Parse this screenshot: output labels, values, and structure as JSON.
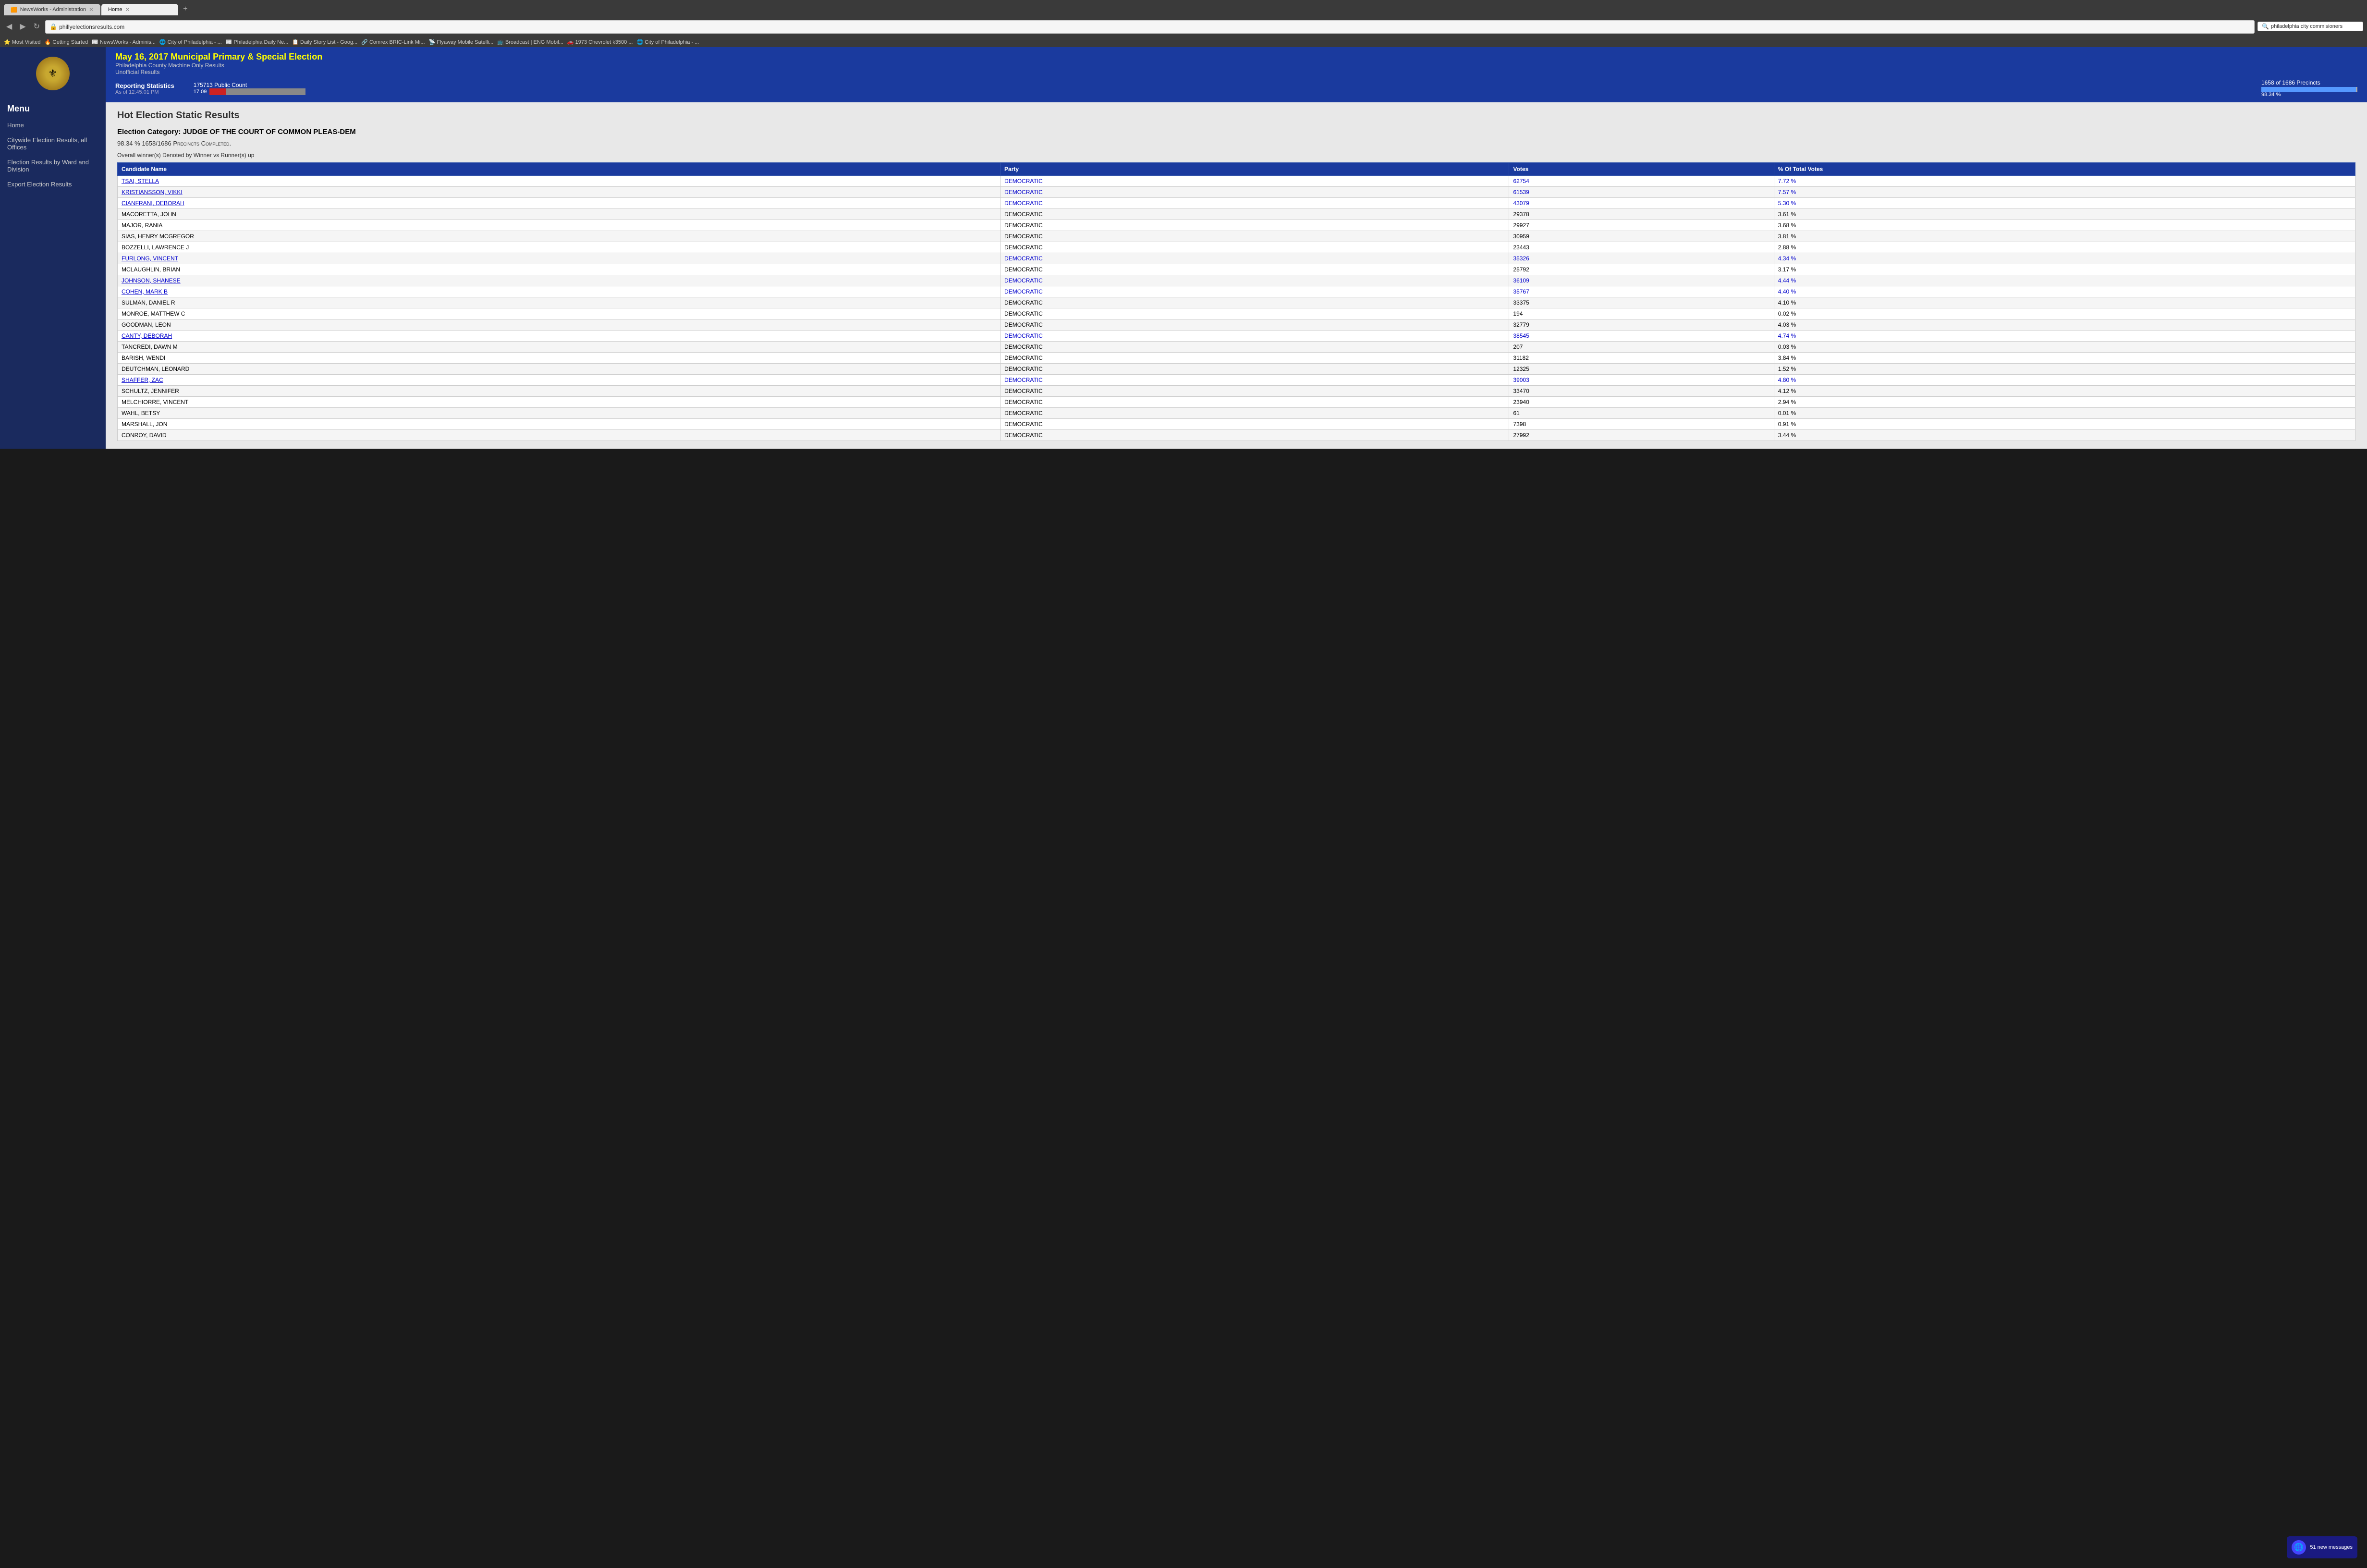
{
  "browser": {
    "tabs": [
      {
        "id": "tab1",
        "label": "NewsWorks - Administration",
        "active": false,
        "icon": "🟧"
      },
      {
        "id": "tab2",
        "label": "Home",
        "active": true,
        "icon": ""
      }
    ],
    "url": "phillyelectionsresults.com",
    "search_text": "philadelphia city commisioners",
    "bookmarks": [
      "Most Visited",
      "Getting Started",
      "NewsWorks - Adminis...",
      "City of Philadelphia - ...",
      "Philadelphia Daily Ne...",
      "Daily Story List - Goog...",
      "Comrex BRIC-Link Mi...",
      "Flyaway Mobile Satelli...",
      "Broadcast | ENG Mobil...",
      "1973 Chevrolet k3500 ...",
      "City of Philadelphia - ..."
    ]
  },
  "header": {
    "election_title": "May 16, 2017 Municipal Primary & Special Election",
    "sub1": "Philadelphia County Machine Only Results",
    "sub2": "Unofficial Results",
    "reporting_label": "Reporting Statistics",
    "as_of": "As of 12:45:01 PM",
    "public_count_label": "175713 Public Count",
    "public_pct": "17.09",
    "precincts_label": "1658 of 1686 Precincts",
    "precincts_pct": "98.34 %"
  },
  "sidebar": {
    "menu_title": "Menu",
    "items": [
      {
        "label": "Home",
        "id": "home"
      },
      {
        "label": "Citywide Election Results, all Offices",
        "id": "citywide"
      },
      {
        "label": "Election Results by Ward and Division",
        "id": "ward-division"
      },
      {
        "label": "Export Election Results",
        "id": "export"
      }
    ]
  },
  "main": {
    "page_title": "Hot Election Static Results",
    "election_category": "Election Category: JUDGE OF THE COURT OF COMMON PLEAS-DEM",
    "precincts_completed": "98.34 % 1658/1686 Precincts Completed.",
    "winner_note": "Overall winner(s) Denoted by Winner vs Runner(s) up",
    "table_headers": [
      "Candidate Name",
      "Party",
      "Votes",
      "% Of Total Votes"
    ],
    "candidates": [
      {
        "name": "TSAI, STELLA",
        "party": "DEMOCRATIC",
        "votes": "62754",
        "pct": "7.72 %",
        "winner": true
      },
      {
        "name": "KRISTIANSSON, VIKKI",
        "party": "DEMOCRATIC",
        "votes": "61539",
        "pct": "7.57 %",
        "winner": true
      },
      {
        "name": "CIANFRANI, DEBORAH",
        "party": "DEMOCRATIC",
        "votes": "43079",
        "pct": "5.30 %",
        "winner": true
      },
      {
        "name": "MACORETTA, JOHN",
        "party": "DEMOCRATIC",
        "votes": "29378",
        "pct": "3.61 %",
        "winner": false
      },
      {
        "name": "MAJOR, RANIA",
        "party": "DEMOCRATIC",
        "votes": "29927",
        "pct": "3.68 %",
        "winner": false
      },
      {
        "name": "SIAS, HENRY MCGREGOR",
        "party": "DEMOCRATIC",
        "votes": "30959",
        "pct": "3.81 %",
        "winner": false
      },
      {
        "name": "BOZZELLI, LAWRENCE J",
        "party": "DEMOCRATIC",
        "votes": "23443",
        "pct": "2.88 %",
        "winner": false
      },
      {
        "name": "FURLONG, VINCENT",
        "party": "DEMOCRATIC",
        "votes": "35326",
        "pct": "4.34 %",
        "winner": true
      },
      {
        "name": "MCLAUGHLIN, BRIAN",
        "party": "DEMOCRATIC",
        "votes": "25792",
        "pct": "3.17 %",
        "winner": false
      },
      {
        "name": "JOHNSON, SHANESE",
        "party": "DEMOCRATIC",
        "votes": "36109",
        "pct": "4.44 %",
        "winner": true
      },
      {
        "name": "COHEN, MARK B",
        "party": "DEMOCRATIC",
        "votes": "35767",
        "pct": "4.40 %",
        "winner": true
      },
      {
        "name": "SULMAN, DANIEL R",
        "party": "DEMOCRATIC",
        "votes": "33375",
        "pct": "4.10 %",
        "winner": false
      },
      {
        "name": "MONROE, MATTHEW C",
        "party": "DEMOCRATIC",
        "votes": "194",
        "pct": "0.02 %",
        "winner": false
      },
      {
        "name": "GOODMAN, LEON",
        "party": "DEMOCRATIC",
        "votes": "32779",
        "pct": "4.03 %",
        "winner": false
      },
      {
        "name": "CANTY, DEBORAH",
        "party": "DEMOCRATIC",
        "votes": "38545",
        "pct": "4.74 %",
        "winner": true
      },
      {
        "name": "TANCREDI, DAWN M",
        "party": "DEMOCRATIC",
        "votes": "207",
        "pct": "0.03 %",
        "winner": false
      },
      {
        "name": "BARISH, WENDI",
        "party": "DEMOCRATIC",
        "votes": "31182",
        "pct": "3.84 %",
        "winner": false
      },
      {
        "name": "DEUTCHMAN, LEONARD",
        "party": "DEMOCRATIC",
        "votes": "12325",
        "pct": "1.52 %",
        "winner": false
      },
      {
        "name": "SHAFFER, ZAC",
        "party": "DEMOCRATIC",
        "votes": "39003",
        "pct": "4.80 %",
        "winner": true
      },
      {
        "name": "SCHULTZ, JENNIFER",
        "party": "DEMOCRATIC",
        "votes": "33470",
        "pct": "4.12 %",
        "winner": false
      },
      {
        "name": "MELCHIORRE, VINCENT",
        "party": "DEMOCRATIC",
        "votes": "23940",
        "pct": "2.94 %",
        "winner": false
      },
      {
        "name": "WAHL, BETSY",
        "party": "DEMOCRATIC",
        "votes": "61",
        "pct": "0.01 %",
        "winner": false
      },
      {
        "name": "MARSHALL, JON",
        "party": "DEMOCRATIC",
        "votes": "7398",
        "pct": "0.91 %",
        "winner": false
      },
      {
        "name": "CONROY, DAVID",
        "party": "DEMOCRATIC",
        "votes": "27992",
        "pct": "3.44 %",
        "winner": false
      }
    ]
  },
  "notification": {
    "count": "51",
    "label": "51 new messages"
  }
}
